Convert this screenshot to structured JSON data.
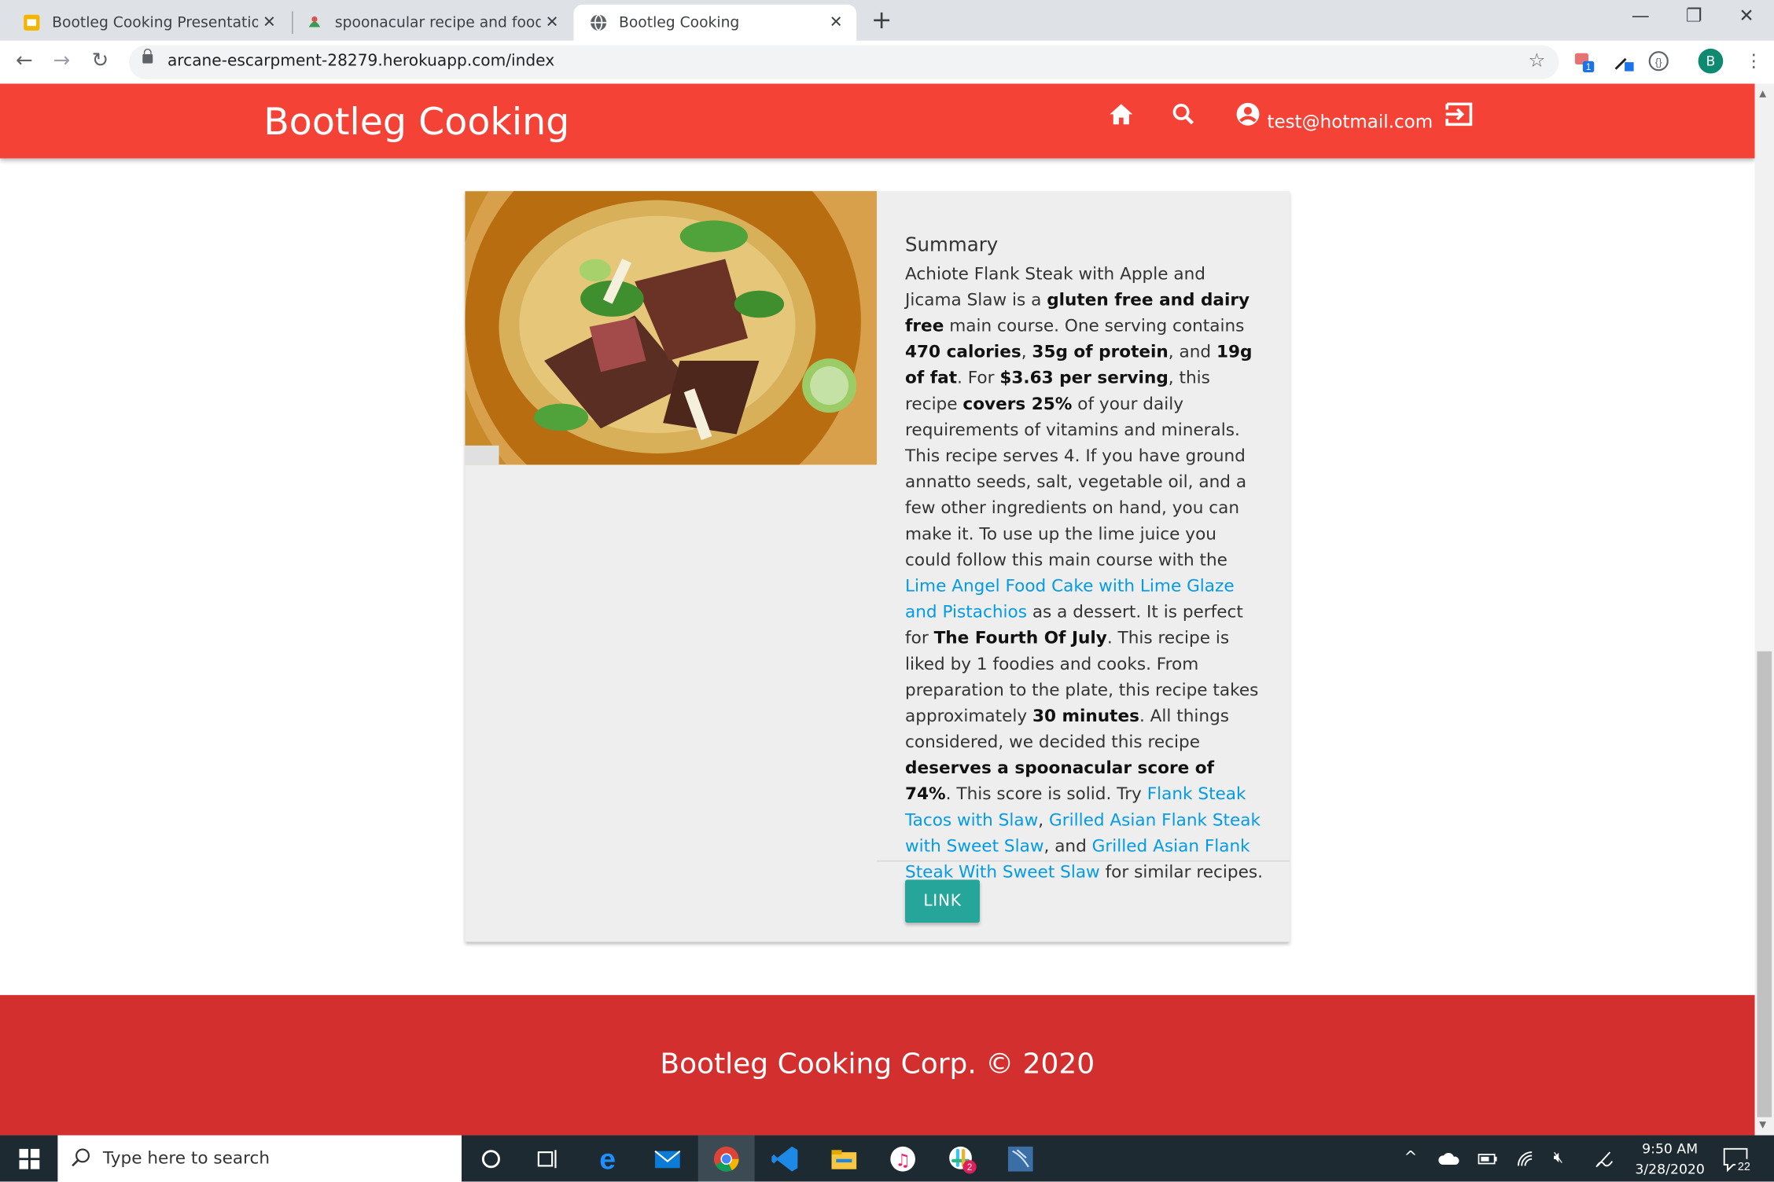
{
  "browser": {
    "tabs": [
      {
        "title": "Bootleg Cooking Presentation - G",
        "active": false
      },
      {
        "title": "spoonacular recipe and food API",
        "active": false
      },
      {
        "title": "Bootleg Cooking",
        "active": true
      }
    ],
    "url": "arcane-escarpment-28279.herokuapp.com/index",
    "profile_initial": "B",
    "extension_badge": "1"
  },
  "app": {
    "brand": "Bootleg Cooking",
    "user_email": "test@hotmail.com",
    "colors": {
      "header": "#f44336",
      "footer": "#d32f2f",
      "button": "#26a69a",
      "link": "#039be5"
    }
  },
  "recipe": {
    "image_alt": "Achiote Flank Steak with Apple and Jicama Slaw",
    "summary_title": "Summary",
    "summary": [
      {
        "t": "Achiote Flank Steak with Apple and Jicama Slaw is a "
      },
      {
        "t": "gluten free and dairy free",
        "b": true
      },
      {
        "t": " main course. One serving contains "
      },
      {
        "t": "470 calories",
        "b": true
      },
      {
        "t": ", "
      },
      {
        "t": "35g of protein",
        "b": true
      },
      {
        "t": ", and "
      },
      {
        "t": "19g of fat",
        "b": true
      },
      {
        "t": ". For "
      },
      {
        "t": "$3.63 per serving",
        "b": true
      },
      {
        "t": ", this recipe "
      },
      {
        "t": "covers 25%",
        "b": true
      },
      {
        "t": " of your daily requirements of vitamins and minerals. This recipe serves 4. If you have ground annatto seeds, salt, vegetable oil, and a few other ingredients on hand, you can make it. To use up the lime juice you could follow this main course with the "
      },
      {
        "t": "Lime Angel Food Cake with Lime Glaze and Pistachios",
        "link": true
      },
      {
        "t": " as a dessert. It is perfect for "
      },
      {
        "t": "The Fourth Of July",
        "b": true
      },
      {
        "t": ". This recipe is liked by 1 foodies and cooks. From preparation to the plate, this recipe takes approximately "
      },
      {
        "t": "30 minutes",
        "b": true
      },
      {
        "t": ". All things considered, we decided this recipe "
      },
      {
        "t": "deserves a spoonacular score of 74%",
        "b": true
      },
      {
        "t": ". This score is solid. Try "
      },
      {
        "t": "Flank Steak Tacos with Slaw",
        "link": true
      },
      {
        "t": ", "
      },
      {
        "t": "Grilled Asian Flank Steak with Sweet Slaw",
        "link": true
      },
      {
        "t": ", and "
      },
      {
        "t": "Grilled Asian Flank Steak With Sweet Slaw",
        "link": true
      },
      {
        "t": " for similar recipes."
      }
    ],
    "button_label": "LINK"
  },
  "footer": {
    "text": "Bootleg Cooking Corp. © 2020"
  },
  "taskbar": {
    "search_placeholder": "Type here to search",
    "time": "9:50 AM",
    "date": "3/28/2020",
    "notification_count": "22",
    "slack_badge": "2"
  }
}
